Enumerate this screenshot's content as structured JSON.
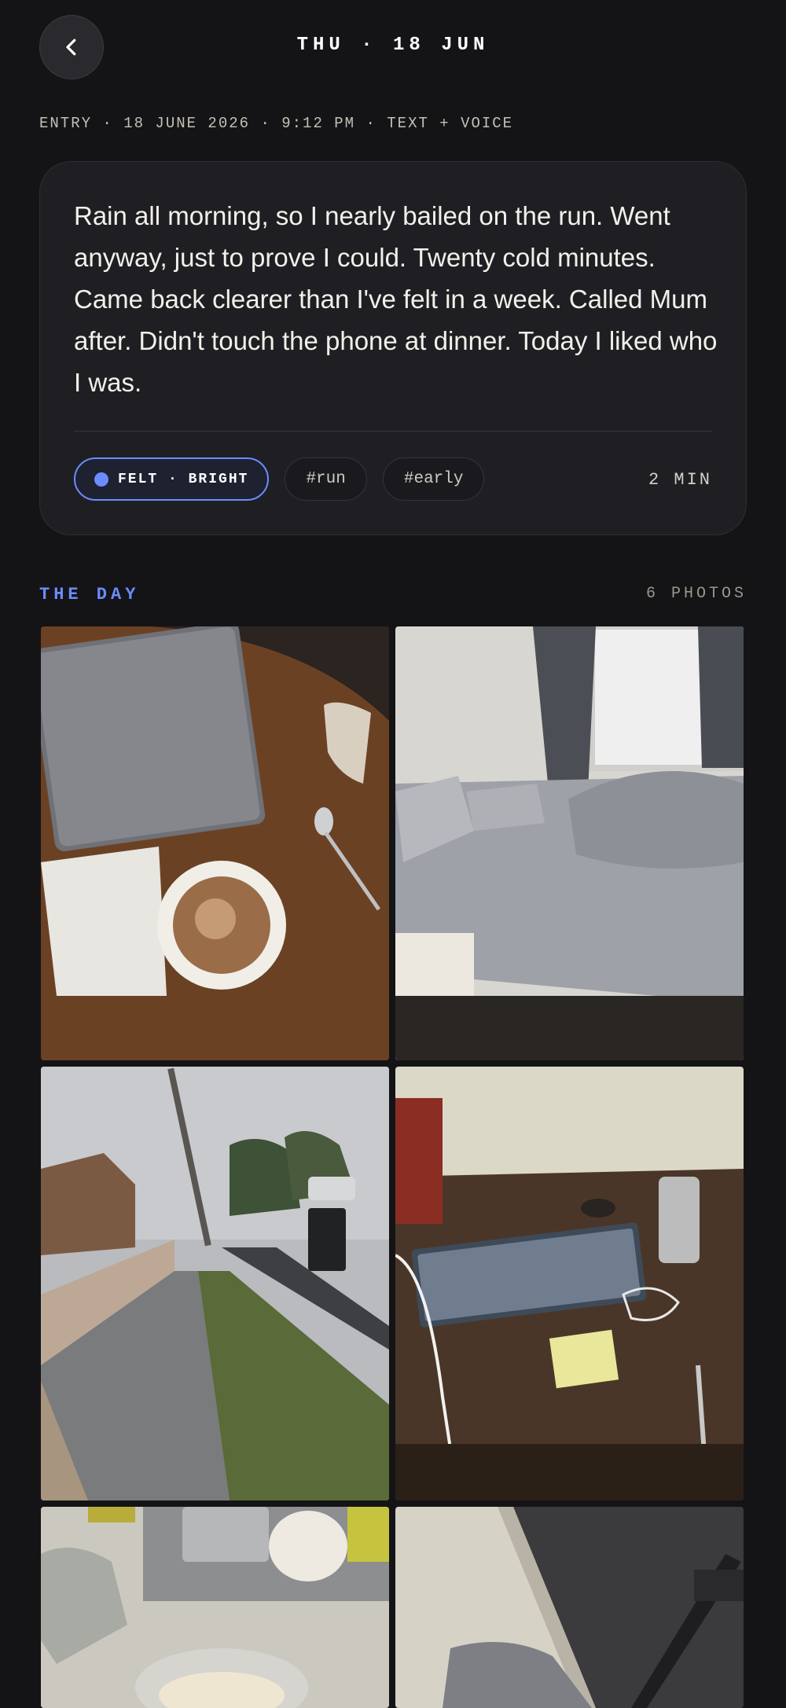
{
  "header": {
    "title": "THU · 18 JUN",
    "back_icon": "chevron-left-icon"
  },
  "meta": {
    "line": "ENTRY · 18 JUNE 2026 · 9:12 PM · TEXT + VOICE"
  },
  "entry": {
    "text": "Rain all morning, so I nearly bailed on the run. Went anyway, just to prove I could. Twenty cold minutes. Came back clearer than I've felt in a week. Called Mum after. Didn't touch the phone at dinner. Today I liked who I was.",
    "mood_label": "FELT · BRIGHT",
    "mood_color": "#6b8cff",
    "tags": [
      "#run",
      "#early"
    ],
    "duration": "2 MIN"
  },
  "section": {
    "title": "THE DAY",
    "count": "6 PHOTOS",
    "accent": "#6b8cff"
  },
  "photos": [
    {
      "subject": "laptop-coffee-table-photo"
    },
    {
      "subject": "bedroom-bed-photo"
    },
    {
      "subject": "rainy-street-footpath-photo"
    },
    {
      "subject": "desk-keyboard-photo"
    },
    {
      "subject": "kitchen-dish-rack-photo"
    },
    {
      "subject": "gym-floor-towel-photo"
    }
  ]
}
